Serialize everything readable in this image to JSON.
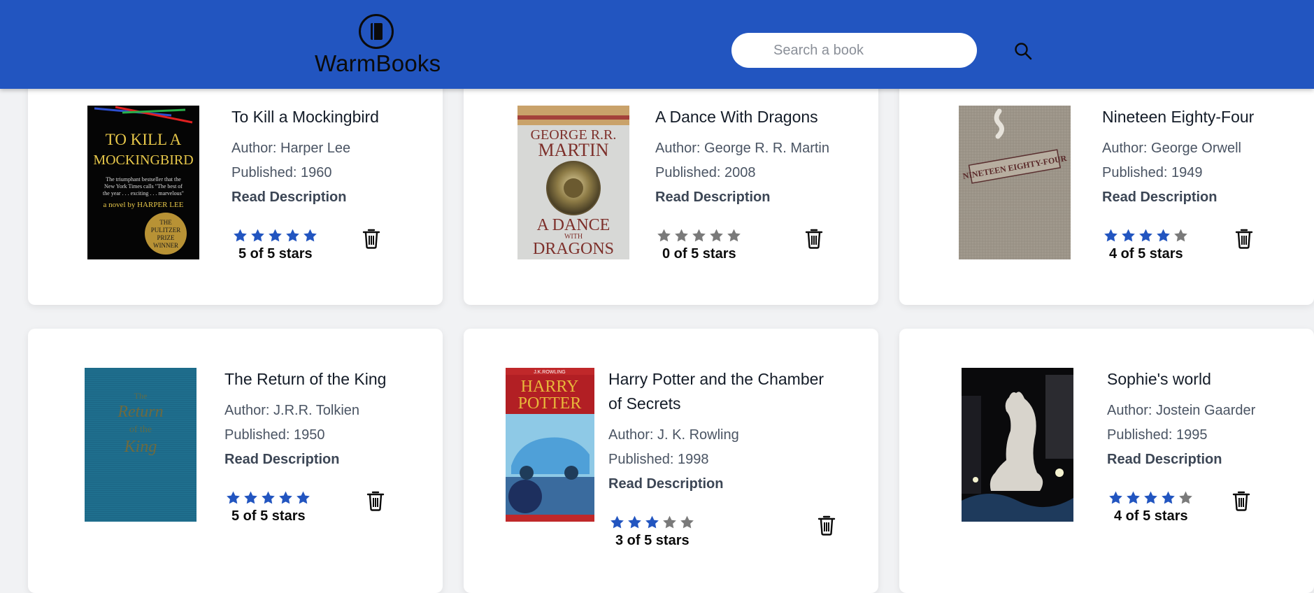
{
  "app": {
    "logo_text": "WarmBooks",
    "brand_color": "#2255c0",
    "star_filled_color": "#2255c0",
    "star_empty_color": "#7a7a7a"
  },
  "search": {
    "placeholder": "Search a book",
    "value": ""
  },
  "read_description_label": "Read Description",
  "books": [
    {
      "title": "To Kill a Mockingbird",
      "author": "Author: Harper Lee",
      "published": "Published: 1960",
      "rating": 5,
      "rating_text": "5 of 5 stars",
      "cover_lines": [
        "TO KILL A",
        "MOCKINGBIRD"
      ],
      "cover_small": [
        "The triumphant bestseller that the",
        "New York Times calls \"The best of",
        "the year . . . exciting . . . marvelous\""
      ],
      "cover_byline": "a novel by HARPER LEE",
      "cover_seal": [
        "THE",
        "PULITZER",
        "PRIZE",
        "WINNER"
      ]
    },
    {
      "title": "A Dance With Dragons",
      "author": "Author: George R. R. Martin",
      "published": "Published: 2008",
      "rating": 0,
      "rating_text": "0 of 5 stars",
      "cover_lines": [
        "GEORGE R.R.",
        "MARTIN",
        "A DANCE",
        "WITH",
        "DRAGONS"
      ]
    },
    {
      "title": "Nineteen Eighty-Four",
      "author": "Author: George Orwell",
      "published": "Published: 1949",
      "rating": 4,
      "rating_text": "4 of 5 stars",
      "cover_lines": [
        "NINETEEN EIGHTY-FOUR"
      ]
    },
    {
      "title": "The Return of the King",
      "author": "Author: J.R.R. Tolkien",
      "published": "Published: 1950",
      "rating": 5,
      "rating_text": "5 of 5 stars",
      "cover_lines": [
        "The",
        "Return",
        "of the",
        "King"
      ]
    },
    {
      "title_line1": "Harry Potter and the Chamber",
      "title_line2": "of Secrets",
      "author": "Author: J. K. Rowling",
      "published": "Published: 1998",
      "rating": 3,
      "rating_text": "3 of 5 stars",
      "cover_lines": [
        "J.K.ROWLING",
        "HARRY",
        "POTTER"
      ]
    },
    {
      "title": "Sophie's world",
      "author": "Author: Jostein Gaarder",
      "published": "Published: 1995",
      "rating": 4,
      "rating_text": "4 of 5 stars"
    }
  ]
}
